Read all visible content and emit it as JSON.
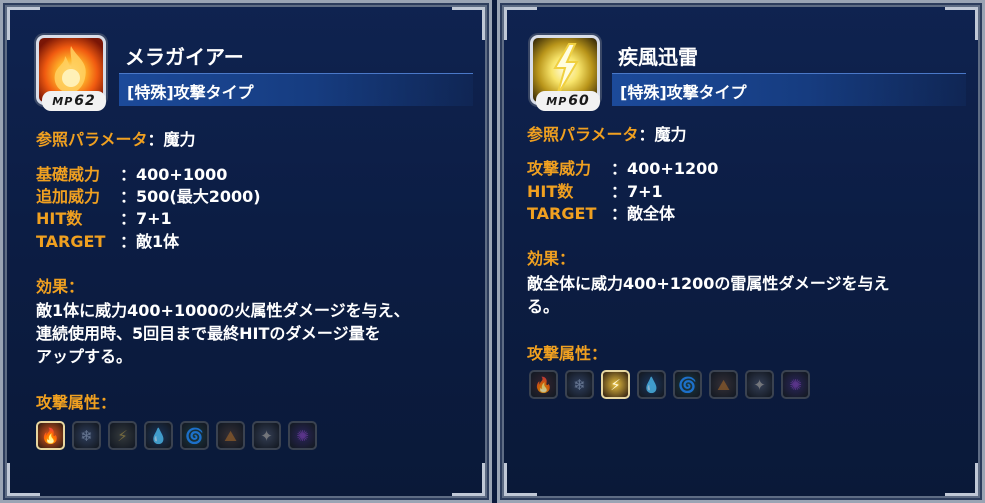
{
  "cards": [
    {
      "name": "メラガイアー",
      "mp_label": "MP",
      "mp": "62",
      "type": "[特殊]攻撃タイプ",
      "ref_label": "参照パラメータ",
      "ref_value": "魔力",
      "stats": [
        {
          "label": "基礎威力",
          "value": "400+1000"
        },
        {
          "label": "追加威力",
          "value": "500(最大2000)"
        },
        {
          "label": "HIT数",
          "value": "7+1"
        },
        {
          "label": "TARGET",
          "value": "敵1体"
        }
      ],
      "effect_label": "効果",
      "effect_lines": [
        "敵1体に威力400+1000の火属性ダメージを与え、",
        "連続使用時、5回目まで最終HITのダメージ量を",
        "アップする。"
      ],
      "attr_label": "攻撃属性",
      "attributes": [
        {
          "icon": "fire-icon",
          "glyph": "🔥",
          "color": "#e85a20",
          "active": true
        },
        {
          "icon": "ice-icon",
          "glyph": "❄",
          "color": "#7a8aa4",
          "active": false
        },
        {
          "icon": "thunder-icon",
          "glyph": "⚡",
          "color": "#8a7a40",
          "active": false
        },
        {
          "icon": "water-icon",
          "glyph": "💧",
          "color": "#3a6a9a",
          "active": false
        },
        {
          "icon": "wind-icon",
          "glyph": "🌀",
          "color": "#3a7a4a",
          "active": false
        },
        {
          "icon": "earth-icon",
          "glyph": "⛰",
          "color": "#8a5a2a",
          "active": false
        },
        {
          "icon": "light-icon",
          "glyph": "✦",
          "color": "#8a8a8a",
          "active": false
        },
        {
          "icon": "dark-icon",
          "glyph": "✺",
          "color": "#6a3a9a",
          "active": false
        }
      ]
    },
    {
      "name": "疾風迅雷",
      "mp_label": "MP",
      "mp": "60",
      "type": "[特殊]攻撃タイプ",
      "ref_label": "参照パラメータ",
      "ref_value": "魔力",
      "stats": [
        {
          "label": "攻撃威力",
          "value": "400+1200"
        },
        {
          "label": "HIT数",
          "value": "7+1"
        },
        {
          "label": "TARGET",
          "value": "敵全体"
        }
      ],
      "effect_label": "効果",
      "effect_lines": [
        "敵全体に威力400+1200の雷属性ダメージを与え",
        "る。"
      ],
      "attr_label": "攻撃属性",
      "attributes": [
        {
          "icon": "fire-icon",
          "glyph": "🔥",
          "color": "#8a3a1a",
          "active": false
        },
        {
          "icon": "ice-icon",
          "glyph": "❄",
          "color": "#7a8aa4",
          "active": false
        },
        {
          "icon": "thunder-icon",
          "glyph": "⚡",
          "color": "#e8c040",
          "active": true
        },
        {
          "icon": "water-icon",
          "glyph": "💧",
          "color": "#3a6a9a",
          "active": false
        },
        {
          "icon": "wind-icon",
          "glyph": "🌀",
          "color": "#3a7a4a",
          "active": false
        },
        {
          "icon": "earth-icon",
          "glyph": "⛰",
          "color": "#8a5a2a",
          "active": false
        },
        {
          "icon": "light-icon",
          "glyph": "✦",
          "color": "#8a8a8a",
          "active": false
        },
        {
          "icon": "dark-icon",
          "glyph": "✺",
          "color": "#6a3a9a",
          "active": false
        }
      ]
    }
  ]
}
